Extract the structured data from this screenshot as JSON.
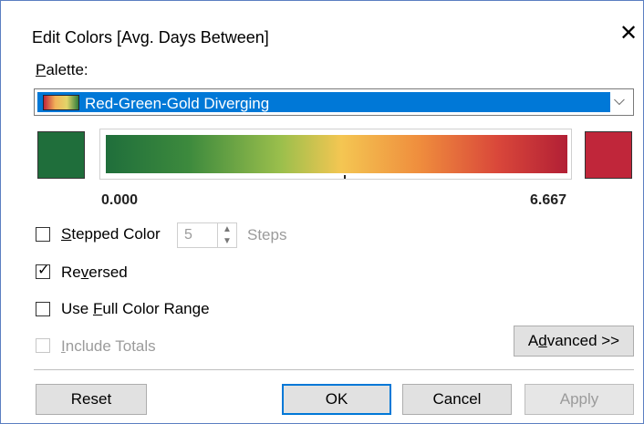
{
  "dialog": {
    "title": "Edit Colors [Avg. Days Between]",
    "close_glyph": "✕"
  },
  "palette": {
    "label": "Palette:",
    "selected": "Red-Green-Gold Diverging",
    "start_color": "#1f6e3b",
    "end_color": "#c0263a",
    "min_value": "0.000",
    "max_value": "6.667"
  },
  "options": {
    "stepped_color": {
      "label": "Stepped Color",
      "checked": false,
      "steps_value": "5",
      "steps_label": "Steps"
    },
    "reversed": {
      "label": "Reversed",
      "checked": true
    },
    "full_range": {
      "label": "Use Full Color Range",
      "checked": false
    },
    "include_totals": {
      "label": "Include Totals",
      "checked": false,
      "enabled": false
    }
  },
  "buttons": {
    "advanced": "Advanced >>",
    "reset": "Reset",
    "ok": "OK",
    "cancel": "Cancel",
    "apply": "Apply"
  }
}
